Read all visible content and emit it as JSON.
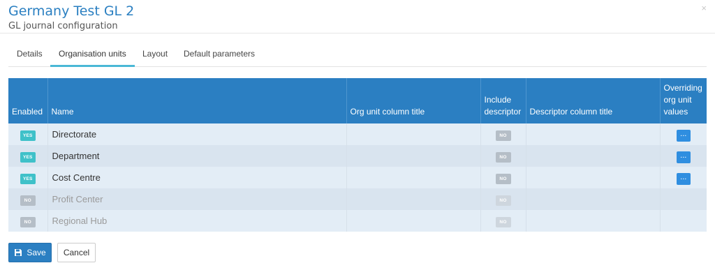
{
  "header": {
    "title": "Germany Test GL 2",
    "subtitle": "GL journal configuration",
    "close_symbol": "×"
  },
  "tabs": [
    {
      "label": "Details",
      "active": false
    },
    {
      "label": "Organisation units",
      "active": true
    },
    {
      "label": "Layout",
      "active": false
    },
    {
      "label": "Default parameters",
      "active": false
    }
  ],
  "table": {
    "columns": {
      "enabled": "Enabled",
      "name": "Name",
      "org_unit_title": "Org unit column title",
      "include_descriptor_1": "Include",
      "include_descriptor_2": "descriptor",
      "descriptor_title": "Descriptor column title",
      "overriding_1": "Overriding",
      "overriding_2": "org unit",
      "overriding_3": "values"
    },
    "rows": [
      {
        "enabled": "YES",
        "name": "Directorate",
        "org_unit_title": "",
        "include_descriptor": "NO",
        "descriptor_title": "",
        "overriding": "..."
      },
      {
        "enabled": "YES",
        "name": "Department",
        "org_unit_title": "",
        "include_descriptor": "NO",
        "descriptor_title": "",
        "overriding": "..."
      },
      {
        "enabled": "YES",
        "name": "Cost Centre",
        "org_unit_title": "",
        "include_descriptor": "NO",
        "descriptor_title": "",
        "overriding": "..."
      },
      {
        "enabled": "NO",
        "name": "Profit Center",
        "org_unit_title": "",
        "include_descriptor": "NO",
        "descriptor_title": "",
        "overriding": ""
      },
      {
        "enabled": "NO",
        "name": "Regional Hub",
        "org_unit_title": "",
        "include_descriptor": "NO",
        "descriptor_title": "",
        "overriding": ""
      }
    ]
  },
  "buttons": {
    "save_label": "Save",
    "save_icon": "floppy-disk-icon",
    "cancel_label": "Cancel"
  },
  "colors": {
    "accent": "#2b7fc2",
    "title": "#2a7fc1",
    "yes_badge": "#3fc1c9",
    "no_badge": "#b5bec7",
    "tab_underline": "#4ab8d6"
  }
}
